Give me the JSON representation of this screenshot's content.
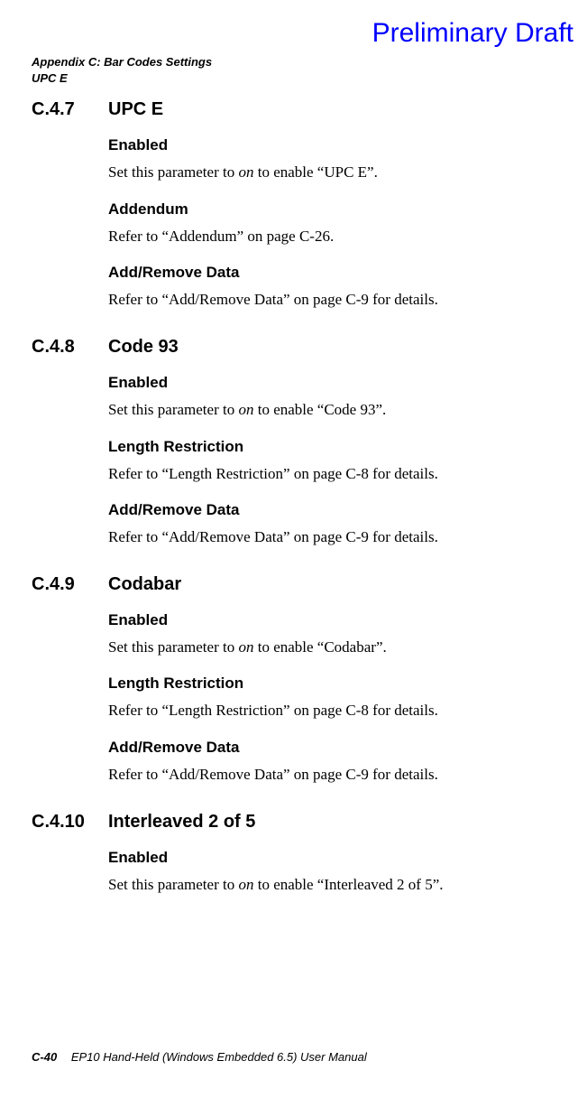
{
  "watermark": "Preliminary Draft",
  "header": {
    "line1": "Appendix C: Bar Codes Settings",
    "line2": "UPC E"
  },
  "sections": [
    {
      "number": "C.4.7",
      "title": "UPC E",
      "subs": [
        {
          "heading": "Enabled",
          "body_pre": "Set this parameter to ",
          "body_italic": "on",
          "body_post": " to enable “UPC E”."
        },
        {
          "heading": "Addendum",
          "body": "Refer to “Addendum” on page C-26."
        },
        {
          "heading": "Add/Remove Data",
          "body": "Refer to “Add/Remove Data” on page C-9 for details."
        }
      ]
    },
    {
      "number": "C.4.8",
      "title": "Code 93",
      "subs": [
        {
          "heading": "Enabled",
          "body_pre": "Set this parameter to ",
          "body_italic": "on",
          "body_post": " to enable “Code 93”."
        },
        {
          "heading": "Length Restriction",
          "body": "Refer to “Length Restriction” on page C-8 for details."
        },
        {
          "heading": "Add/Remove Data",
          "body": "Refer to “Add/Remove Data” on page C-9 for details."
        }
      ]
    },
    {
      "number": "C.4.9",
      "title": " Codabar",
      "subs": [
        {
          "heading": "Enabled",
          "body_pre": "Set this parameter to ",
          "body_italic": "on",
          "body_post": " to enable “Codabar”."
        },
        {
          "heading": "Length Restriction",
          "body": "Refer to “Length Restriction” on page C-8 for details."
        },
        {
          "heading": "Add/Remove Data",
          "body": "Refer to “Add/Remove Data” on page C-9 for details."
        }
      ]
    },
    {
      "number": "C.4.10",
      "title": " Interleaved 2 of 5",
      "subs": [
        {
          "heading": "Enabled",
          "body_pre": "Set this parameter to ",
          "body_italic": "on",
          "body_post": " to enable “Interleaved 2 of 5”."
        }
      ]
    }
  ],
  "footer": {
    "page": "C-40",
    "text": "EP10 Hand-Held (Windows Embedded 6.5) User Manual"
  }
}
